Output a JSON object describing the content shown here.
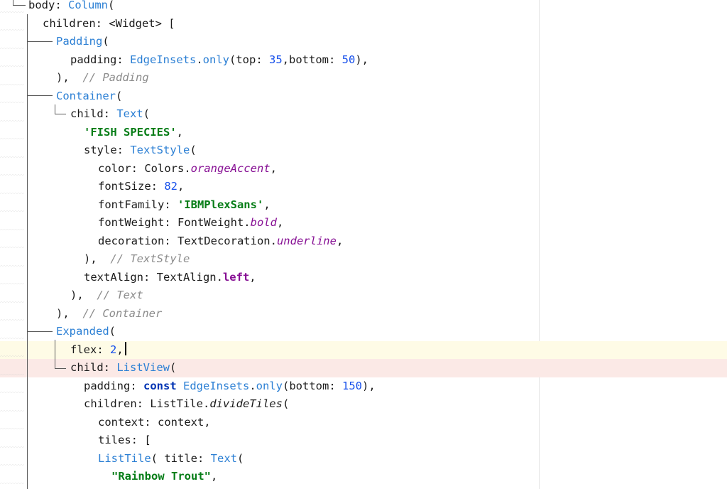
{
  "editor": {
    "highlight_colors": {
      "current_line": "#fefbe6",
      "error_line": "#fbe9e6"
    },
    "token_colors": {
      "class": "#2b7fd4",
      "number": "#1750eb",
      "string": "#067d17",
      "comment": "#8c8c8c",
      "field": "#871094",
      "keyword": "#0033b3"
    },
    "lines": [
      {
        "tokens": [
          {
            "t": "body: ",
            "c": "plain"
          },
          {
            "t": "Column",
            "c": "cls"
          },
          {
            "t": "(",
            "c": "plain"
          }
        ]
      },
      {
        "tokens": [
          {
            "t": "children: <Widget> [",
            "c": "plain"
          }
        ]
      },
      {
        "tokens": [
          {
            "t": "Padding",
            "c": "cls"
          },
          {
            "t": "(",
            "c": "plain"
          }
        ]
      },
      {
        "tokens": [
          {
            "t": "padding: ",
            "c": "plain"
          },
          {
            "t": "EdgeInsets",
            "c": "cls"
          },
          {
            "t": ".",
            "c": "plain"
          },
          {
            "t": "only",
            "c": "cls"
          },
          {
            "t": "(top: ",
            "c": "plain"
          },
          {
            "t": "35",
            "c": "num"
          },
          {
            "t": ",bottom: ",
            "c": "plain"
          },
          {
            "t": "50",
            "c": "num"
          },
          {
            "t": "),",
            "c": "plain"
          }
        ]
      },
      {
        "tokens": [
          {
            "t": "),  ",
            "c": "plain"
          },
          {
            "t": "// Padding",
            "c": "cmt"
          }
        ]
      },
      {
        "tokens": [
          {
            "t": "Container",
            "c": "cls"
          },
          {
            "t": "(",
            "c": "plain"
          }
        ]
      },
      {
        "tokens": [
          {
            "t": "child: ",
            "c": "plain"
          },
          {
            "t": "Text",
            "c": "cls"
          },
          {
            "t": "(",
            "c": "plain"
          }
        ]
      },
      {
        "tokens": [
          {
            "t": "'FISH SPECIES'",
            "c": "str"
          },
          {
            "t": ",",
            "c": "plain"
          }
        ]
      },
      {
        "tokens": [
          {
            "t": "style: ",
            "c": "plain"
          },
          {
            "t": "TextStyle",
            "c": "cls"
          },
          {
            "t": "(",
            "c": "plain"
          }
        ]
      },
      {
        "tokens": [
          {
            "t": "color: Colors.",
            "c": "plain"
          },
          {
            "t": "orangeAccent",
            "c": "field"
          },
          {
            "t": ",",
            "c": "plain"
          }
        ]
      },
      {
        "tokens": [
          {
            "t": "fontSize: ",
            "c": "plain"
          },
          {
            "t": "82",
            "c": "num"
          },
          {
            "t": ",",
            "c": "plain"
          }
        ]
      },
      {
        "tokens": [
          {
            "t": "fontFamily: ",
            "c": "plain"
          },
          {
            "t": "'IBMPlexSans'",
            "c": "str"
          },
          {
            "t": ",",
            "c": "plain"
          }
        ]
      },
      {
        "tokens": [
          {
            "t": "fontWeight: FontWeight.",
            "c": "plain"
          },
          {
            "t": "bold",
            "c": "field"
          },
          {
            "t": ",",
            "c": "plain"
          }
        ]
      },
      {
        "tokens": [
          {
            "t": "decoration: TextDecoration.",
            "c": "plain"
          },
          {
            "t": "underline",
            "c": "field"
          },
          {
            "t": ",",
            "c": "plain"
          }
        ]
      },
      {
        "tokens": [
          {
            "t": "),  ",
            "c": "plain"
          },
          {
            "t": "// TextStyle",
            "c": "cmt"
          }
        ]
      },
      {
        "tokens": [
          {
            "t": "textAlign: TextAlign.",
            "c": "plain"
          },
          {
            "t": "left",
            "c": "bold"
          },
          {
            "t": ",",
            "c": "plain"
          }
        ]
      },
      {
        "tokens": [
          {
            "t": "),  ",
            "c": "plain"
          },
          {
            "t": "// Text",
            "c": "cmt"
          }
        ]
      },
      {
        "tokens": [
          {
            "t": "),  ",
            "c": "plain"
          },
          {
            "t": "// Container",
            "c": "cmt"
          }
        ]
      },
      {
        "tokens": [
          {
            "t": "Expanded",
            "c": "cls"
          },
          {
            "t": "(",
            "c": "plain"
          }
        ]
      },
      {
        "tokens": [
          {
            "t": "flex: ",
            "c": "plain"
          },
          {
            "t": "2",
            "c": "num"
          },
          {
            "t": ",",
            "c": "plain"
          }
        ]
      },
      {
        "tokens": [
          {
            "t": "child: ",
            "c": "plain"
          },
          {
            "t": "ListView",
            "c": "cls"
          },
          {
            "t": "(",
            "c": "plain"
          }
        ]
      },
      {
        "tokens": [
          {
            "t": "padding: ",
            "c": "plain"
          },
          {
            "t": "const ",
            "c": "kw"
          },
          {
            "t": "EdgeInsets",
            "c": "cls"
          },
          {
            "t": ".",
            "c": "plain"
          },
          {
            "t": "only",
            "c": "cls"
          },
          {
            "t": "(bottom: ",
            "c": "plain"
          },
          {
            "t": "150",
            "c": "num"
          },
          {
            "t": "),",
            "c": "plain"
          }
        ]
      },
      {
        "tokens": [
          {
            "t": "children: ListTile.",
            "c": "plain"
          },
          {
            "t": "divideTiles",
            "c": "ital"
          },
          {
            "t": "(",
            "c": "plain"
          }
        ]
      },
      {
        "tokens": [
          {
            "t": "context: context,",
            "c": "plain"
          }
        ]
      },
      {
        "tokens": [
          {
            "t": "tiles: [",
            "c": "plain"
          }
        ]
      },
      {
        "tokens": [
          {
            "t": "ListTile",
            "c": "cls"
          },
          {
            "t": "( title: ",
            "c": "plain"
          },
          {
            "t": "Text",
            "c": "cls"
          },
          {
            "t": "(",
            "c": "plain"
          }
        ]
      },
      {
        "tokens": [
          {
            "t": "\"Rainbow Trout\"",
            "c": "str"
          },
          {
            "t": ",",
            "c": "plain"
          }
        ]
      }
    ]
  }
}
